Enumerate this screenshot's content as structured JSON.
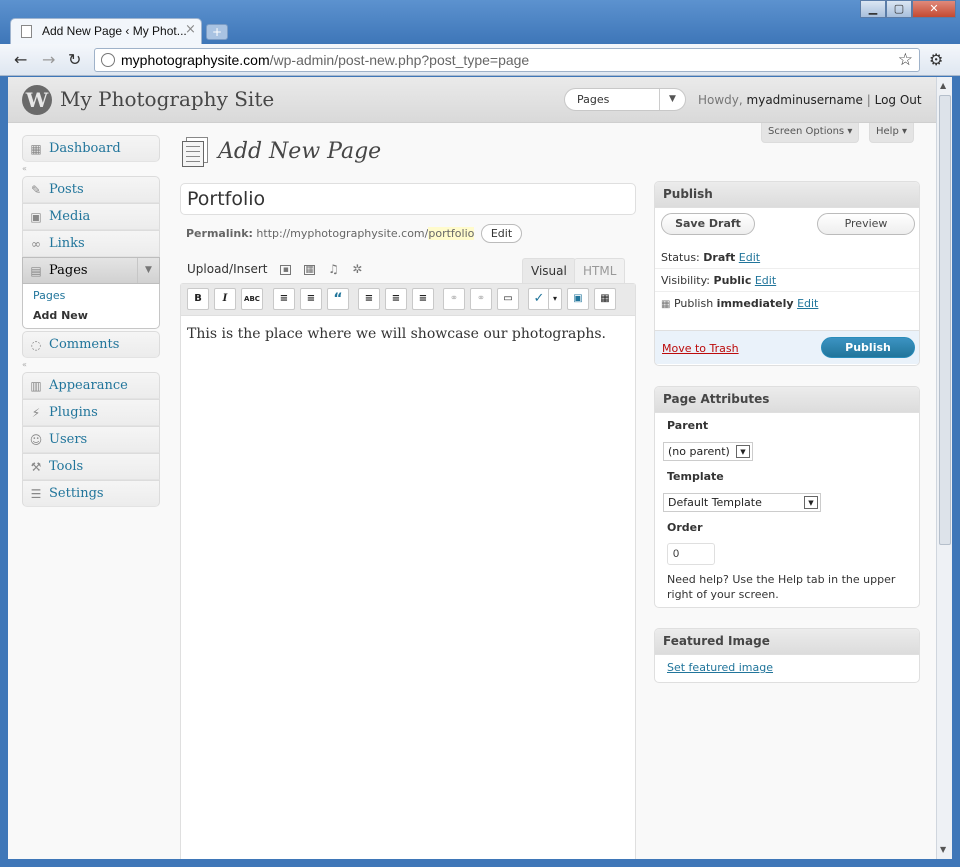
{
  "browser": {
    "tab_title": "Add New Page ‹ My Phot...",
    "tab_close": "×",
    "new_tab": "+",
    "url_domain": "myphotographysite.com",
    "url_path": "/wp-admin/post-new.php?post_type=page",
    "minimize": "▁",
    "maximize": "▢",
    "close": "✕",
    "back": "←",
    "forward": "→",
    "reload": "↻",
    "star": "☆",
    "wrench": "🔧"
  },
  "header": {
    "logo": "W",
    "site_name": "My Photography Site",
    "favorites_select": "Pages",
    "howdy": "Howdy, ",
    "username": "myadminusername",
    "divider": " | ",
    "logout": "Log Out"
  },
  "screen_options": "Screen Options ▾",
  "help": "Help ▾",
  "menu": {
    "dashboard": "Dashboard",
    "posts": "Posts",
    "media": "Media",
    "links": "Links",
    "pages": "Pages",
    "pages_sub": [
      "Pages",
      "Add New"
    ],
    "comments": "Comments",
    "appearance": "Appearance",
    "plugins": "Plugins",
    "users": "Users",
    "tools": "Tools",
    "settings": "Settings",
    "collapse": "«"
  },
  "main": {
    "heading": "Add New Page",
    "title_value": "Portfolio",
    "permalink_label": "Permalink:",
    "permalink_base": "http://myphotographysite.com/",
    "permalink_slug": "portfolio",
    "permalink_edit": "Edit",
    "upload_insert": "Upload/Insert",
    "tab_visual": "Visual",
    "tab_html": "HTML",
    "content": "This is the place where we will showcase our photographs.",
    "toolbar": [
      "B",
      "I",
      "ABC",
      "≡",
      "≡",
      "“",
      "≡",
      "≡",
      "≡",
      "⚭",
      "⚭",
      "▭",
      "✓",
      "▾",
      "▣",
      "▦"
    ]
  },
  "publish": {
    "title": "Publish",
    "save_draft": "Save Draft",
    "preview": "Preview",
    "status_label": "Status: ",
    "status_value": "Draft",
    "visibility_label": "Visibility: ",
    "visibility_value": "Public",
    "publish_label": "Publish ",
    "publish_value": "immediately",
    "edit": "Edit",
    "move_to_trash": "Move to Trash",
    "publish_button": "Publish"
  },
  "page_attributes": {
    "title": "Page Attributes",
    "parent_label": "Parent",
    "parent_value": "(no parent)",
    "template_label": "Template",
    "template_value": "Default Template",
    "order_label": "Order",
    "order_value": "0",
    "help_text": "Need help? Use the Help tab in the upper right of your screen."
  },
  "featured_image": {
    "title": "Featured Image",
    "link": "Set featured image"
  }
}
